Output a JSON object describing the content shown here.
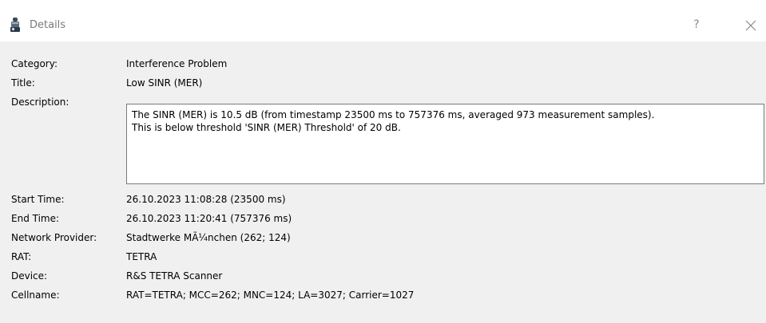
{
  "window": {
    "title": "Details",
    "help_label": "?"
  },
  "fields": {
    "category": {
      "label": "Category:",
      "value": "Interference Problem"
    },
    "title": {
      "label": "Title:",
      "value": "Low SINR (MER)"
    },
    "description": {
      "label": "Description:",
      "lines": [
        "The SINR (MER) is 10.5 dB (from timestamp 23500 ms to 757376 ms, averaged 973 measurement samples).",
        "This is below threshold 'SINR (MER) Threshold' of 20 dB."
      ]
    },
    "start_time": {
      "label": "Start Time:",
      "value": "26.10.2023 11:08:28 (23500 ms)"
    },
    "end_time": {
      "label": "End Time:",
      "value": "26.10.2023 11:20:41 (757376 ms)"
    },
    "network_provider": {
      "label": "Network Provider:",
      "value": "Stadtwerke MÃ¼nchen (262; 124)"
    },
    "rat": {
      "label": "RAT:",
      "value": "TETRA"
    },
    "device": {
      "label": "Device:",
      "value": "R&S TETRA Scanner"
    },
    "cellname": {
      "label": "Cellname:",
      "value": "RAT=TETRA; MCC=262; MNC=124; LA=3027; Carrier=1027"
    }
  },
  "colors": {
    "titlebar_bg": "#ffffff",
    "content_bg": "#f0f0f0",
    "title_text": "#7a7a7a",
    "accent": "#e8a040"
  }
}
